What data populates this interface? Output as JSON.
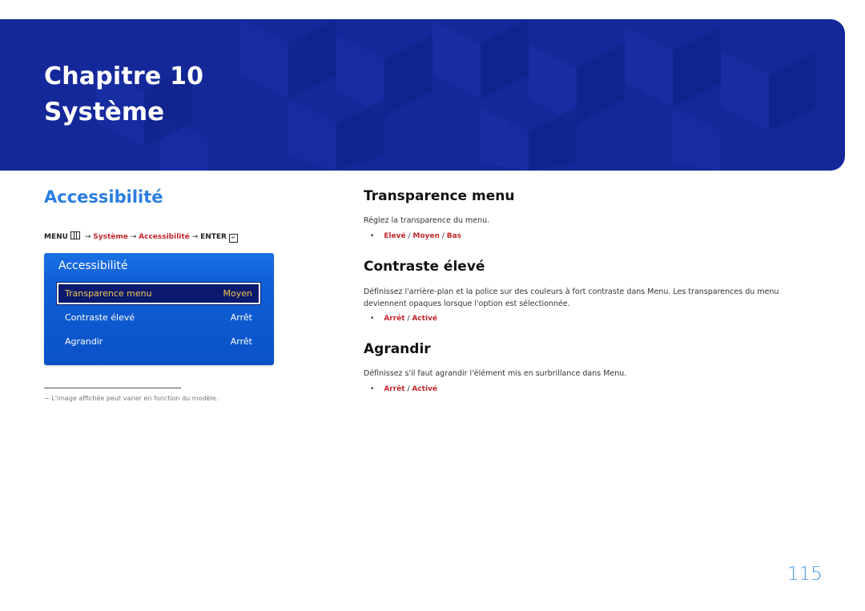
{
  "header": {
    "chapter": "Chapitre 10",
    "title": "Système"
  },
  "left": {
    "section_title": "Accessibilité",
    "menu_path": {
      "menu": "MENU",
      "menu_icon": "menu-grid-icon",
      "arrow": "→",
      "systeme": "Système",
      "accessibilite": "Accessibilité",
      "enter": "ENTER",
      "enter_icon": "enter-icon"
    },
    "osd": {
      "title": "Accessibilité",
      "rows": [
        {
          "label": "Transparence menu",
          "value": "Moyen"
        },
        {
          "label": "Contraste élevé",
          "value": "Arrêt"
        },
        {
          "label": "Agrandir",
          "value": "Arrêt"
        }
      ]
    },
    "footnote": "−  L'image affichée peut varier en fonction du modèle."
  },
  "right": {
    "sections": [
      {
        "heading": "Transparence menu",
        "text": "Réglez la transparence du menu.",
        "options": [
          "Elevé",
          "Moyen",
          "Bas"
        ]
      },
      {
        "heading": "Contraste élevé",
        "text": "Définissez l'arrière-plan et la police sur des couleurs à fort contraste dans Menu. Les transparences du menu deviennent opaques lorsque l'option est sélectionnée.",
        "options": [
          "Arrêt",
          "Activé"
        ]
      },
      {
        "heading": "Agrandir",
        "text": "Définissez s'il faut agrandir l'élément mis en surbrillance dans Menu.",
        "options": [
          "Arrêt",
          "Activé"
        ]
      }
    ],
    "bullet": "•",
    "separator": "/"
  },
  "page_number": "115",
  "colors": {
    "banner": "#14289a",
    "accent_blue": "#2a7de1",
    "option_red": "#c1272d",
    "osd_highlight_text": "#f5c64d"
  }
}
